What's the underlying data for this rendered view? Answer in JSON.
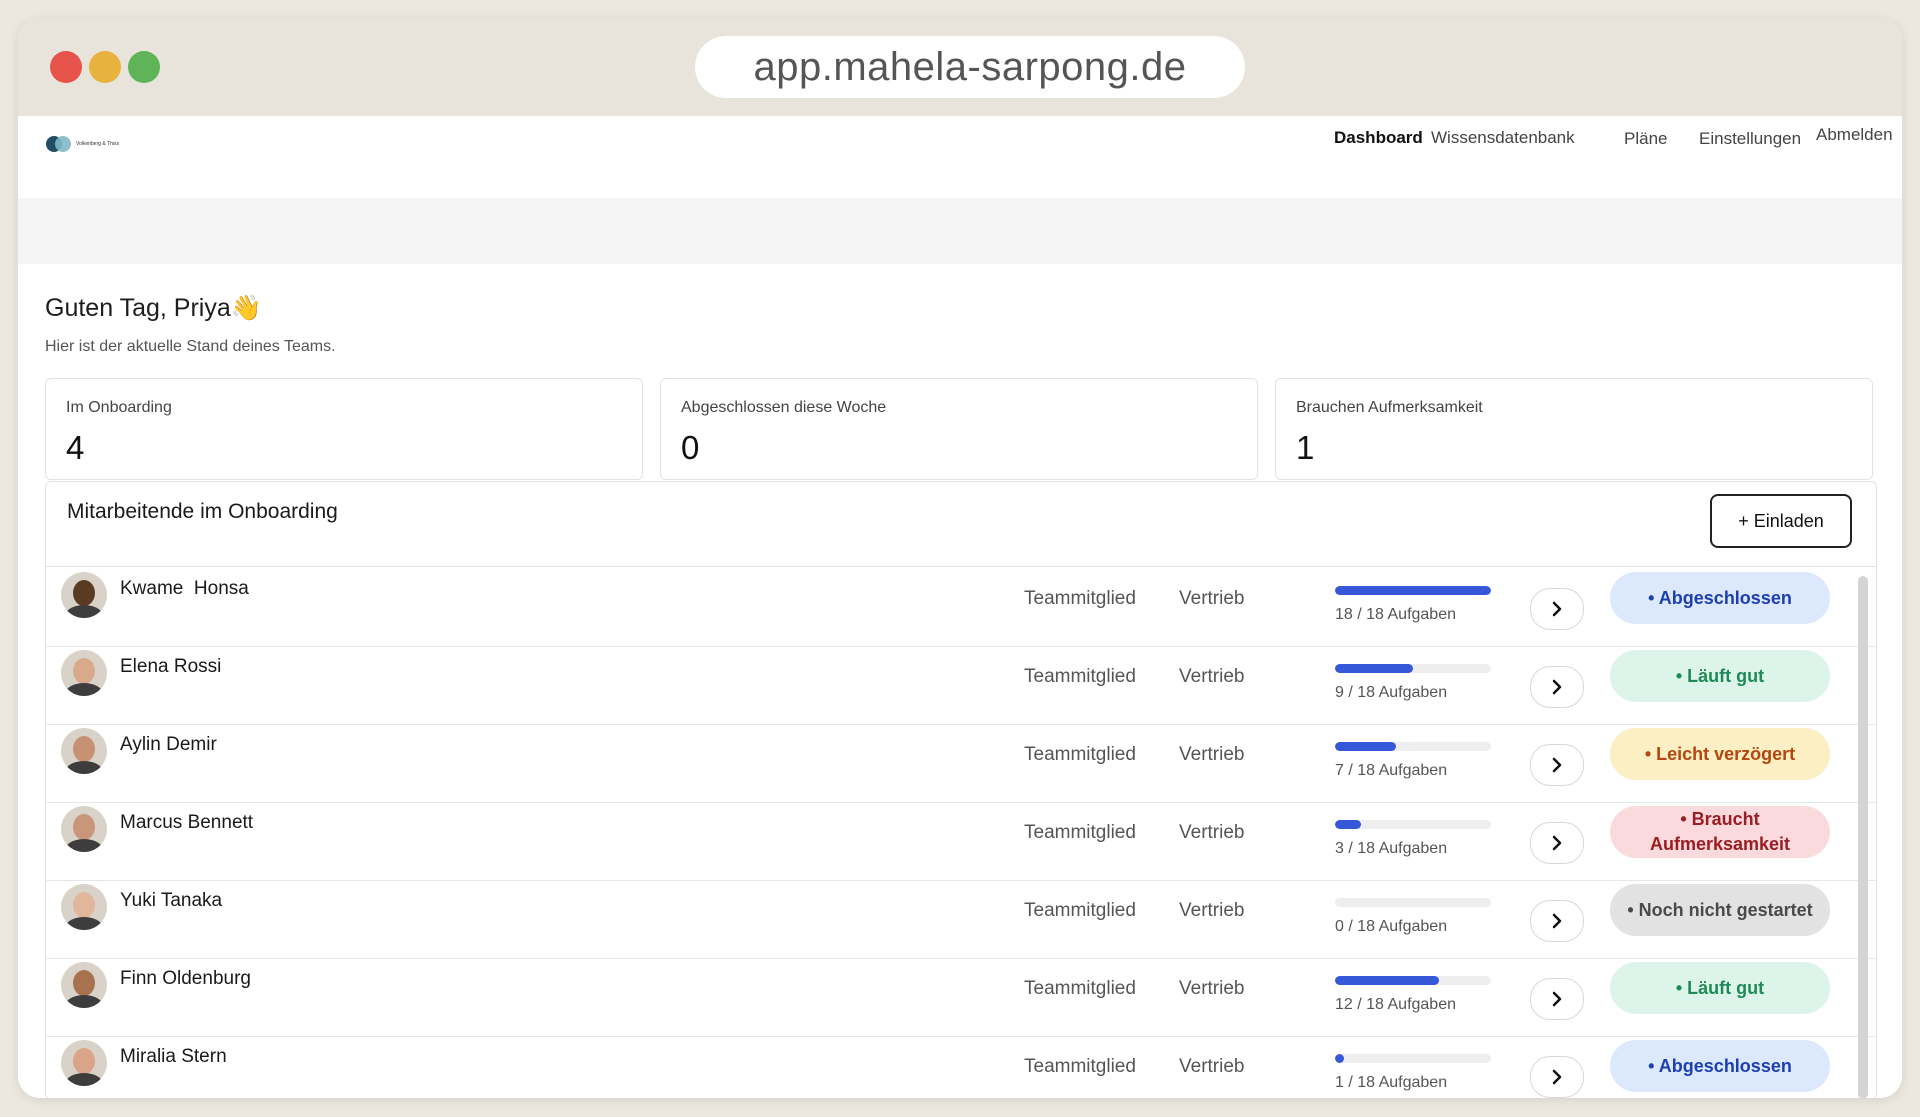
{
  "browser": {
    "url": "app.mahela-sarpong.de"
  },
  "header": {
    "brand": "Volkenberg & Thiss",
    "nav": [
      "Dashboard",
      "Wissensdatenbank",
      "Pläne",
      "Einstellungen",
      "Abmelden"
    ]
  },
  "greeting": {
    "title": "Guten Tag, Priya👋",
    "subtitle": "Hier ist der aktuelle Stand deines Teams."
  },
  "stats": [
    {
      "label": "Im Onboarding",
      "value": "4"
    },
    {
      "label": "Abgeschlossen diese Woche",
      "value": "0"
    },
    {
      "label": "Brauchen Aufmerksamkeit",
      "value": "1"
    }
  ],
  "employees_panel": {
    "title": "Mitarbeitende im Onboarding",
    "invite_label": "+ Einladen",
    "rows": [
      {
        "name": "Kwame  Honsa",
        "role": "Teammitglied",
        "department": "Vertrieb",
        "tasks": "18 / 18 Aufgaben",
        "progress": 1.0,
        "status": "• Abgeschlossen",
        "status_kind": "done",
        "skin": "#5a3a22"
      },
      {
        "name": "Elena Rossi",
        "role": "Teammitglied",
        "department": "Vertrieb",
        "tasks": "9 / 18 Aufgaben",
        "progress": 0.5,
        "status": "• Läuft gut",
        "status_kind": "good",
        "skin": "#d8a98b"
      },
      {
        "name": "Aylin Demir",
        "role": "Teammitglied",
        "department": "Vertrieb",
        "tasks": "7 / 18 Aufgaben",
        "progress": 0.389,
        "status": "• Leicht verzögert",
        "status_kind": "delayed",
        "skin": "#c79274"
      },
      {
        "name": "Marcus Bennett",
        "role": "Teammitglied",
        "department": "Vertrieb",
        "tasks": "3 / 18 Aufgaben",
        "progress": 0.167,
        "status": "• Braucht Aufmerksamkeit",
        "status_kind": "attention",
        "skin": "#c9967a"
      },
      {
        "name": "Yuki Tanaka",
        "role": "Teammitglied",
        "department": "Vertrieb",
        "tasks": "0 / 18 Aufgaben",
        "progress": 0.0,
        "status": "• Noch nicht gestartet",
        "status_kind": "notstarted",
        "skin": "#e0b79b"
      },
      {
        "name": "Finn Oldenburg",
        "role": "Teammitglied",
        "department": "Vertrieb",
        "tasks": "12 / 18 Aufgaben",
        "progress": 0.667,
        "status": "• Läuft gut",
        "status_kind": "good",
        "skin": "#a9724f"
      },
      {
        "name": "Miralia Stern",
        "role": "Teammitglied",
        "department": "Vertrieb",
        "tasks": "1 / 18 Aufgaben",
        "progress": 0.056,
        "status": "• Abgeschlossen",
        "status_kind": "done",
        "skin": "#d9a48a"
      }
    ]
  },
  "status_colors": {
    "done": {
      "bg": "#dce8fb",
      "fg": "#1e40af"
    },
    "good": {
      "bg": "#dcf4ea",
      "fg": "#1f8a57"
    },
    "delayed": {
      "bg": "#fcefc4",
      "fg": "#b4460f"
    },
    "attention": {
      "bg": "#fadadd",
      "fg": "#9b1c22"
    },
    "notstarted": {
      "bg": "#e2e2e2",
      "fg": "#4a4a4a"
    }
  },
  "icons": {
    "row_action": "chevron-right-icon"
  }
}
